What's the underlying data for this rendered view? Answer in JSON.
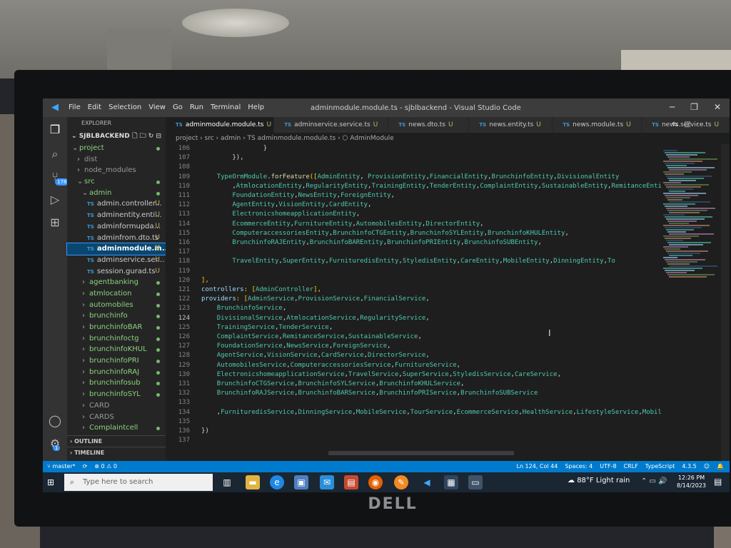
{
  "window": {
    "title": "adminmodule.module.ts - sjblbackend - Visual Studio Code",
    "menu": [
      "File",
      "Edit",
      "Selection",
      "View",
      "Go",
      "Run",
      "Terminal",
      "Help"
    ]
  },
  "activity": {
    "scm_badge": "178",
    "accounts_badge": "1"
  },
  "sidebar": {
    "header": "EXPLORER",
    "project": "SJBLBACKEND",
    "tree": [
      {
        "label": "project",
        "arrow": "⌄",
        "indent": 1,
        "kind": "folder",
        "dot": true
      },
      {
        "label": "dist",
        "arrow": "›",
        "indent": 2,
        "kind": "folder-dim"
      },
      {
        "label": "node_modules",
        "arrow": "›",
        "indent": 2,
        "kind": "folder-dim"
      },
      {
        "label": "src",
        "arrow": "⌄",
        "indent": 2,
        "kind": "folder",
        "dot": true
      },
      {
        "label": "admin",
        "arrow": "⌄",
        "indent": 3,
        "kind": "folder",
        "dot": true
      },
      {
        "label": "admin.controller...",
        "indent": 4,
        "kind": "ts",
        "git": "U"
      },
      {
        "label": "adminentity.enti...",
        "indent": 4,
        "kind": "ts",
        "git": "U"
      },
      {
        "label": "adminformupda...",
        "indent": 4,
        "kind": "ts",
        "git": "U"
      },
      {
        "label": "adminfrom.dto.ts",
        "indent": 4,
        "kind": "ts",
        "git": "U"
      },
      {
        "label": "adminmodule.m...",
        "indent": 4,
        "kind": "ts",
        "git": "U",
        "selected": true
      },
      {
        "label": "adminservice.ser...",
        "indent": 4,
        "kind": "ts",
        "git": "U"
      },
      {
        "label": "session.gurad.ts",
        "indent": 4,
        "kind": "ts",
        "git": "U"
      },
      {
        "label": "agentbanking",
        "arrow": "›",
        "indent": 3,
        "kind": "folder",
        "dot": true
      },
      {
        "label": "atmlocation",
        "arrow": "›",
        "indent": 3,
        "kind": "folder",
        "dot": true
      },
      {
        "label": "automobiles",
        "arrow": "›",
        "indent": 3,
        "kind": "folder",
        "dot": true
      },
      {
        "label": "brunchinfo",
        "arrow": "›",
        "indent": 3,
        "kind": "folder",
        "dot": true
      },
      {
        "label": "brunchinfoBAR",
        "arrow": "›",
        "indent": 3,
        "kind": "folder",
        "dot": true
      },
      {
        "label": "brunchinfoctg",
        "arrow": "›",
        "indent": 3,
        "kind": "folder",
        "dot": true
      },
      {
        "label": "brunchinfoKHUL",
        "arrow": "›",
        "indent": 3,
        "kind": "folder",
        "dot": true
      },
      {
        "label": "brunchinfoPRI",
        "arrow": "›",
        "indent": 3,
        "kind": "folder",
        "dot": true
      },
      {
        "label": "brunchinfoRAJ",
        "arrow": "›",
        "indent": 3,
        "kind": "folder",
        "dot": true
      },
      {
        "label": "brunchinfosub",
        "arrow": "›",
        "indent": 3,
        "kind": "folder",
        "dot": true
      },
      {
        "label": "brunchinfoSYL",
        "arrow": "›",
        "indent": 3,
        "kind": "folder",
        "dot": true
      },
      {
        "label": "CARD",
        "arrow": "›",
        "indent": 3,
        "kind": "folder-dim"
      },
      {
        "label": "CARDS",
        "arrow": "›",
        "indent": 3,
        "kind": "folder-dim"
      },
      {
        "label": "Complaintcell",
        "arrow": "›",
        "indent": 3,
        "kind": "folder",
        "dot": true
      }
    ],
    "outline": "OUTLINE",
    "timeline": "TIMELINE"
  },
  "tabs": [
    {
      "label": "adminmodule.module.ts",
      "active": true,
      "marker": "U",
      "close": "✕"
    },
    {
      "label": "adminservice.service.ts",
      "marker": "U"
    },
    {
      "label": "news.dto.ts",
      "marker": "U"
    },
    {
      "label": "news.entity.ts",
      "marker": "U"
    },
    {
      "label": "news.module.ts",
      "marker": "U"
    },
    {
      "label": "news.service.ts",
      "marker": "U"
    }
  ],
  "breadcrumb": "project › src › admin › TS adminmodule.module.ts › ⬡ AdminModule",
  "editor": {
    "current_line": "124",
    "lines": [
      {
        "n": "106",
        "text": "                }"
      },
      {
        "n": "107",
        "text": "        }),"
      },
      {
        "n": "108",
        "text": ""
      },
      {
        "n": "109",
        "text": "    TypeOrmModule.forFeature([AdminEntity, ProvisionEntity,FinancialEntity,BrunchinfoEntity,DivisionalEntity"
      },
      {
        "n": "110",
        "text": "        ,AtmlocationEntity,RegularityEntity,TrainingEntity,TenderEntity,ComplaintEntity,SustainableEntity,RemitanceEntit"
      },
      {
        "n": "111",
        "text": "        FoundationEntity,NewsEntity,ForeignEntity,"
      },
      {
        "n": "112",
        "text": "        AgentEntity,VisionEntity,CardEntity,"
      },
      {
        "n": "113",
        "text": "        ElectronicshomeapplicationEntity,"
      },
      {
        "n": "114",
        "text": "        EcommerceEntity,FurnitureEntity,AutomobilesEntity,DirectorEntity,"
      },
      {
        "n": "115",
        "text": "        ComputeraccessoriesEntity,BrunchinfoCTGEntity,BrunchinfoSYLEntity,BrunchinfoKHULEntity,"
      },
      {
        "n": "116",
        "text": "        BrunchinfoRAJEntity,BrunchinfoBAREntity,BrunchinfoPRIEntity,BrunchinfoSUBEntity,"
      },
      {
        "n": "117",
        "text": ""
      },
      {
        "n": "118",
        "text": "        TravelEntity,SuperEntity,FurnituredisEntity,StyledisEntity,CareEntity,MobileEntity,DinningEntity,To"
      },
      {
        "n": "119",
        "text": ""
      },
      {
        "n": "120",
        "text": "],"
      },
      {
        "n": "121",
        "text": "controllers: [AdminController],"
      },
      {
        "n": "122",
        "text": "providers: [AdminService,ProvisionService,FinancialService,"
      },
      {
        "n": "123",
        "text": "    BrunchinfoService,"
      },
      {
        "n": "124",
        "text": "    DivisionalService,AtmlocationService,RegularityService,"
      },
      {
        "n": "125",
        "text": "    TrainingService,TenderService,"
      },
      {
        "n": "126",
        "text": "    ComplaintService,RemitanceService,SustainableService,"
      },
      {
        "n": "127",
        "text": "    FoundationService,NewsService,ForeignService,"
      },
      {
        "n": "128",
        "text": "    AgentService,VisionService,CardService,DirectorService,"
      },
      {
        "n": "129",
        "text": "    AutomobilesService,ComputeraccessoriesService,FurnitureService,"
      },
      {
        "n": "130",
        "text": "    ElectronicshomeapplicationService,TravelService,SuperService,StyledisService,CareService,"
      },
      {
        "n": "131",
        "text": "    BrunchinfoCTGService,BrunchinfoSYLService,BrunchinfoKHULService,"
      },
      {
        "n": "132",
        "text": "    BrunchinfoRAJService,BrunchinfoBARService,BrunchinfoPRIService,BrunchinfoSUBService"
      },
      {
        "n": "133",
        "text": ""
      },
      {
        "n": "134",
        "text": "    ,FurnituredisService,DinningService,MobileService,TourService,EcommerceService,HealthService,LifestyleService,Mobile"
      },
      {
        "n": "135",
        "text": ""
      },
      {
        "n": "136",
        "text": "})"
      },
      {
        "n": "137",
        "text": ""
      }
    ]
  },
  "statusbar": {
    "branch": "master*",
    "sync": "⟳",
    "problems": "⊗ 0 ⚠ 0",
    "position": "Ln 124, Col 44",
    "spaces": "Spaces: 4",
    "encoding": "UTF-8",
    "eol": "CRLF",
    "language": "TypeScript",
    "ts_version": "4.3.5"
  },
  "taskbar": {
    "search_placeholder": "Type here to search",
    "weather": "88°F  Light rain",
    "time": "12:26 PM",
    "date": "8/14/2023"
  },
  "brand": {
    "monitor_logo": "DELL"
  },
  "colors": {
    "accent": "#007acc",
    "keyword": "#569cd6",
    "func": "#dcdcaa",
    "ident": "#4ec9b0",
    "text": "#9cdcfe"
  }
}
